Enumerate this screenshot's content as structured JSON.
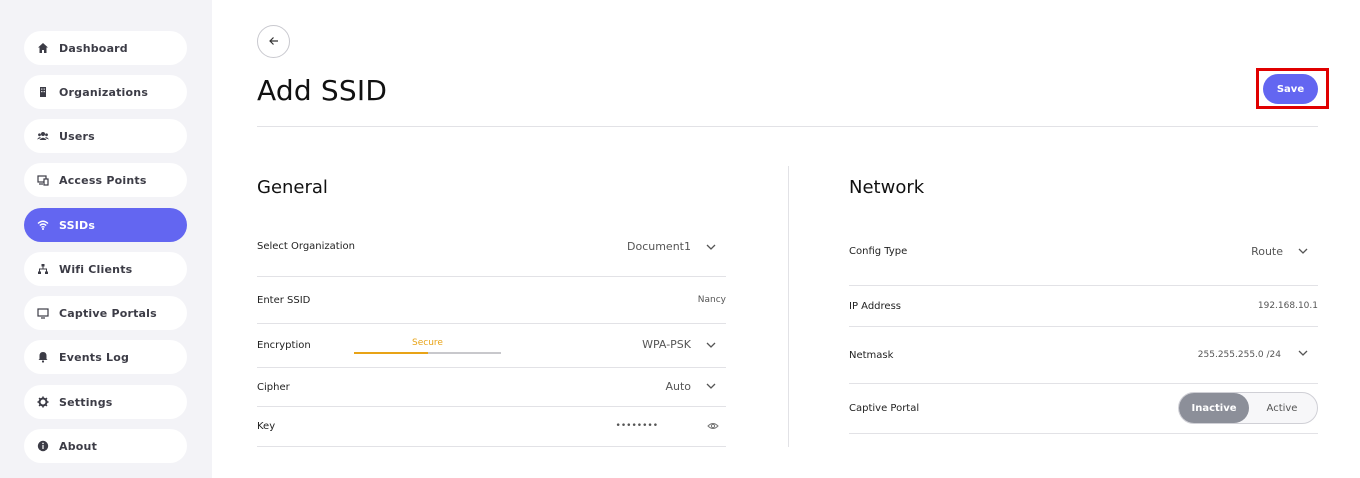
{
  "sidebar": {
    "items": [
      {
        "label": "Dashboard",
        "icon": "home-icon"
      },
      {
        "label": "Organizations",
        "icon": "building-icon"
      },
      {
        "label": "Users",
        "icon": "users-icon"
      },
      {
        "label": "Access Points",
        "icon": "devices-icon"
      },
      {
        "label": "SSIDs",
        "icon": "wifi-icon",
        "active": true
      },
      {
        "label": "Wifi Clients",
        "icon": "network-icon"
      },
      {
        "label": "Captive Portals",
        "icon": "monitor-icon"
      },
      {
        "label": "Events Log",
        "icon": "bell-icon"
      },
      {
        "label": "Settings",
        "icon": "gear-icon"
      },
      {
        "label": "About",
        "icon": "info-icon"
      }
    ]
  },
  "header": {
    "title": "Add SSID",
    "save_label": "Save"
  },
  "general": {
    "title": "General",
    "organization": {
      "label": "Select Organization",
      "value": "Document1"
    },
    "ssid": {
      "label": "Enter SSID",
      "value": "Nancy"
    },
    "encryption": {
      "label": "Encryption",
      "value": "WPA-PSK",
      "strength_label": "Secure",
      "strength_level": 0.5
    },
    "cipher": {
      "label": "Cipher",
      "value": "Auto"
    },
    "key": {
      "label": "Key",
      "value": "••••••••"
    }
  },
  "network": {
    "title": "Network",
    "config_type": {
      "label": "Config Type",
      "value": "Route"
    },
    "ip_address": {
      "label": "IP Address",
      "value": "192.168.10.1"
    },
    "netmask": {
      "label": "Netmask",
      "value": "255.255.255.0 /24"
    },
    "captive_portal": {
      "label": "Captive Portal",
      "inactive_label": "Inactive",
      "active_label": "Active",
      "selected": "Inactive"
    }
  },
  "colors": {
    "accent": "#6366f1",
    "strength": "#e8a317",
    "highlight_frame": "#e00000"
  }
}
